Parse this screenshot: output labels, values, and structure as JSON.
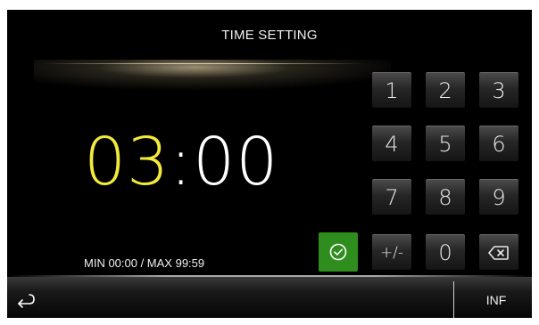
{
  "header": {
    "title": "TIME SETTING"
  },
  "display": {
    "minutes": "03",
    "separator": ":",
    "seconds": "00",
    "minutes_color": "#f2ea3c"
  },
  "range_label": "MIN 00:00 / MAX 99:59",
  "keypad": {
    "keys": [
      "1",
      "2",
      "3",
      "4",
      "5",
      "6",
      "7",
      "8",
      "9",
      "+/-",
      "0"
    ],
    "confirm_icon": "check-circle-icon",
    "confirm_color": "#2f8d1e",
    "backspace_icon": "backspace-icon"
  },
  "footer": {
    "back_icon": "return-arrow-icon",
    "info_label": "INF"
  }
}
